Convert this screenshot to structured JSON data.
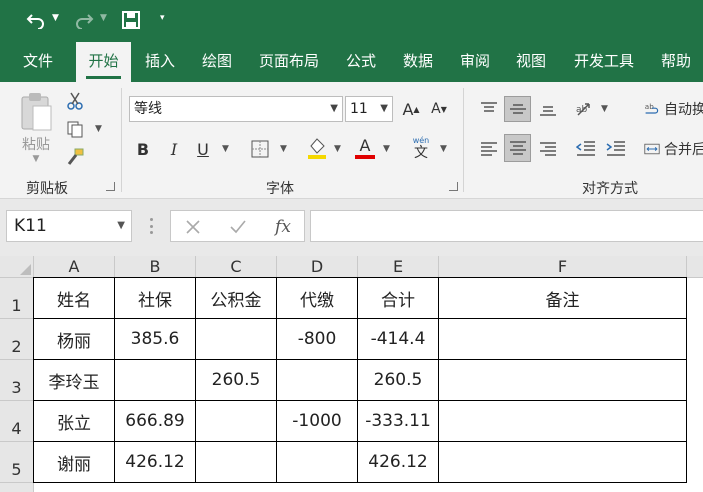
{
  "qat": {
    "icons": [
      "undo-icon",
      "redo-icon",
      "save-icon",
      "customize-icon"
    ],
    "colors": {
      "brand": "#217346"
    }
  },
  "tabs": [
    "文件",
    "开始",
    "插入",
    "绘图",
    "页面布局",
    "公式",
    "数据",
    "审阅",
    "视图",
    "开发工具",
    "帮助"
  ],
  "active_tab": "开始",
  "ribbon": {
    "clipboard": {
      "label": "剪贴板",
      "paste": "粘贴"
    },
    "font": {
      "label": "字体",
      "name": "等线",
      "size": "11",
      "bold": "B",
      "italic": "I",
      "underline": "U",
      "font_color_letter": "A",
      "grow": "A",
      "shrink": "A",
      "phonetic": "wén"
    },
    "alignment": {
      "label": "对齐方式",
      "wrap": "自动换",
      "merge": "合并后"
    }
  },
  "formula_bar": {
    "name_box": "K11",
    "fx": "fx"
  },
  "sheet": {
    "columns": [
      "A",
      "B",
      "C",
      "D",
      "E",
      "F"
    ],
    "rows": [
      "1",
      "2",
      "3",
      "4",
      "5"
    ],
    "cells": [
      [
        "姓名",
        "社保",
        "公积金",
        "代缴",
        "合计",
        "备注"
      ],
      [
        "杨丽",
        "385.6",
        "",
        "-800",
        "-414.4",
        ""
      ],
      [
        "李玲玉",
        "",
        "260.5",
        "",
        "260.5",
        ""
      ],
      [
        "张立",
        "666.89",
        "",
        "-1000",
        "-333.11",
        ""
      ],
      [
        "谢丽",
        "426.12",
        "",
        "",
        "426.12",
        ""
      ]
    ]
  }
}
